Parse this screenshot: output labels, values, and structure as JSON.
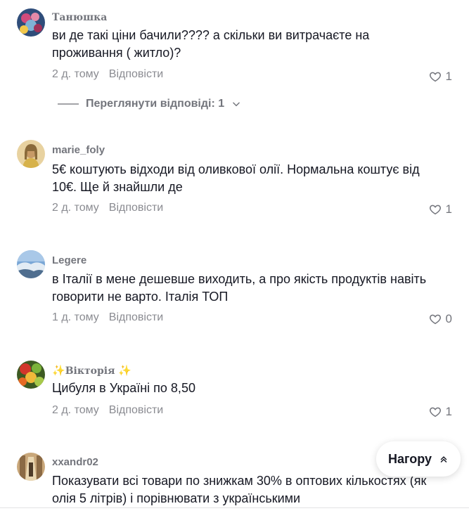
{
  "comments": [
    {
      "username": "Танюшка",
      "text": "ви де такі ціни бачили???? а скільки ви витрачаєте на проживання ( житло)?",
      "time": "2 д. тому",
      "reply_label": "Відповісти",
      "likes": "1",
      "avatar_colors": [
        "#3b5a8a",
        "#d14b7c",
        "#7fb2d6"
      ]
    },
    {
      "username": "marie_foly",
      "text": "5€ коштують відходи від оливкової олії. Нормальна коштує від 10€. Ще й знайшли де",
      "time": "2 д. тому",
      "reply_label": "Відповісти",
      "likes": "1",
      "avatar_colors": [
        "#c7a46a",
        "#e8d2a0",
        "#8a6a3a"
      ]
    },
    {
      "username": "Legere",
      "text": "в Італії в мене дешевше виходить, а про якість продуктів навіть говорити не варто. Італія ТОП",
      "time": "1 д. тому",
      "reply_label": "Відповісти",
      "likes": "0",
      "avatar_colors": [
        "#7aa7d6",
        "#d7e5f2",
        "#4f6e8f"
      ]
    },
    {
      "username": "Вікторія",
      "username_prefix": "✨",
      "username_suffix": "✨",
      "text": "Цибуля в Україні по 8,50",
      "time": "2 д. тому",
      "reply_label": "Відповісти",
      "likes": "1",
      "avatar_colors": [
        "#d2362b",
        "#7bb33a",
        "#f0b93a"
      ]
    },
    {
      "username": "xxandr02",
      "text": "Показувати всі товари по знижкам 30% в оптових кількостях (як олія 5 літрів) і порівнювати з українськими",
      "avatar_colors": [
        "#8b6a45",
        "#c9a77a",
        "#4e3b28"
      ]
    }
  ],
  "view_replies": "Переглянути відповіді: 1",
  "back_to_top": "Нагору",
  "colors": {
    "text": "#161823",
    "secondary": "#73757c",
    "muted": "#8a8b91"
  }
}
